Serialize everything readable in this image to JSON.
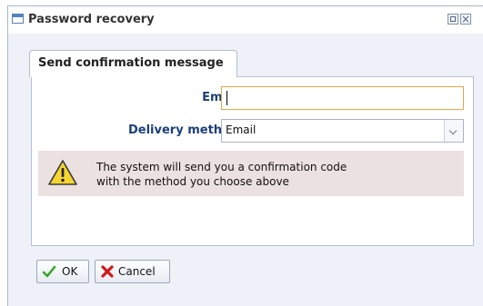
{
  "window": {
    "title": "Password recovery"
  },
  "tab": {
    "label": "Send confirmation message"
  },
  "form": {
    "email_label": "Email :",
    "email_value": "",
    "delivery_label": "Delivery method :",
    "delivery_selected": "Email"
  },
  "notice": {
    "line1": "The system will send you a confirmation code",
    "line2": "with the method you choose above",
    "icon": "warning-icon"
  },
  "buttons": {
    "ok_label": "OK",
    "cancel_label": "Cancel"
  },
  "colors": {
    "label_blue": "#1d3f7a",
    "focus_border": "#e3a84a",
    "notice_bg": "#ece1e1",
    "window_bg": "#eef1f7"
  }
}
